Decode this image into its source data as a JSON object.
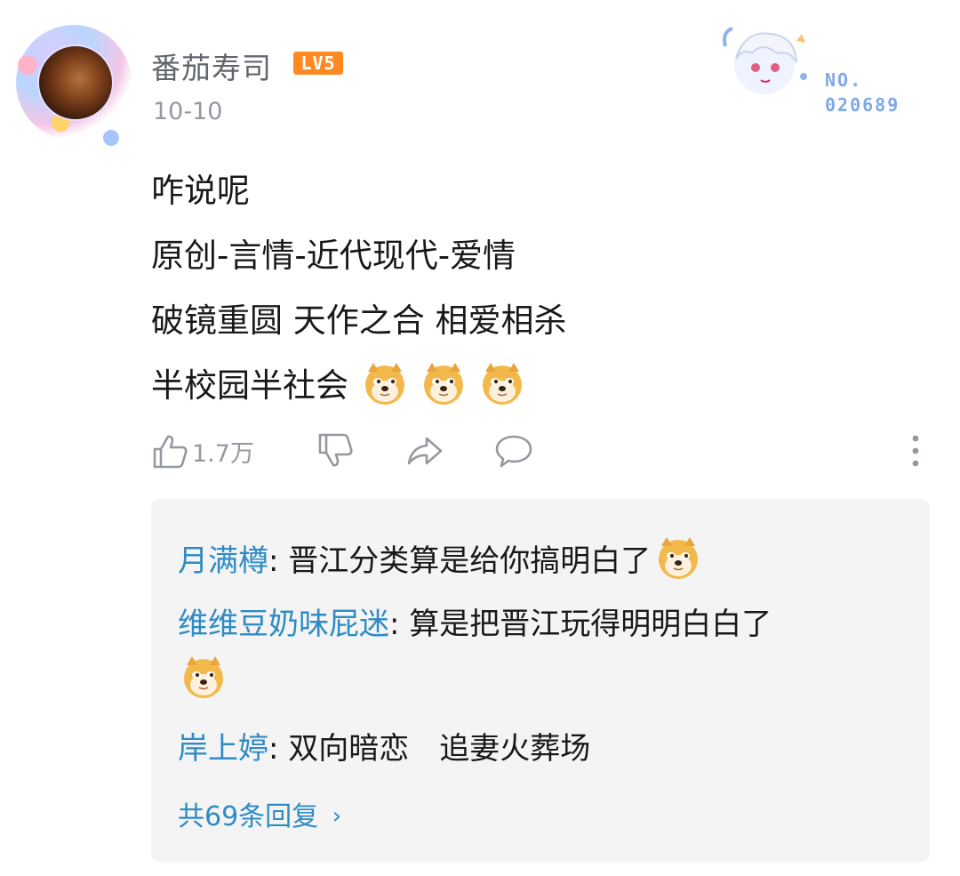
{
  "comment": {
    "username": "番茄寿司",
    "level": "LV5",
    "date": "10-10",
    "fan_badge": {
      "no_label": "NO.",
      "number": "020689"
    },
    "lines": [
      "咋说呢",
      "原创-言情-近代现代-爱情",
      "破镜重圆 天作之合 相爱相杀",
      "半校园半社会"
    ],
    "actions": {
      "like_count": "1.7万"
    }
  },
  "replies": {
    "items": [
      {
        "user": "月满樽",
        "sep": ": ",
        "text": "晋江分类算是给你搞明白了"
      },
      {
        "user": "维维豆奶味屁迷",
        "sep": ": ",
        "text": "算是把晋江玩得明明白白了"
      },
      {
        "user": "岸上婷",
        "sep": ": ",
        "text": "双向暗恋　追妻火葬场"
      }
    ],
    "more_label": "共69条回复"
  },
  "colors": {
    "link": "#2e8bc4",
    "level_badge": "#ff8a22",
    "secondary_text": "#9499a0",
    "reply_bg": "#f4f4f5"
  }
}
